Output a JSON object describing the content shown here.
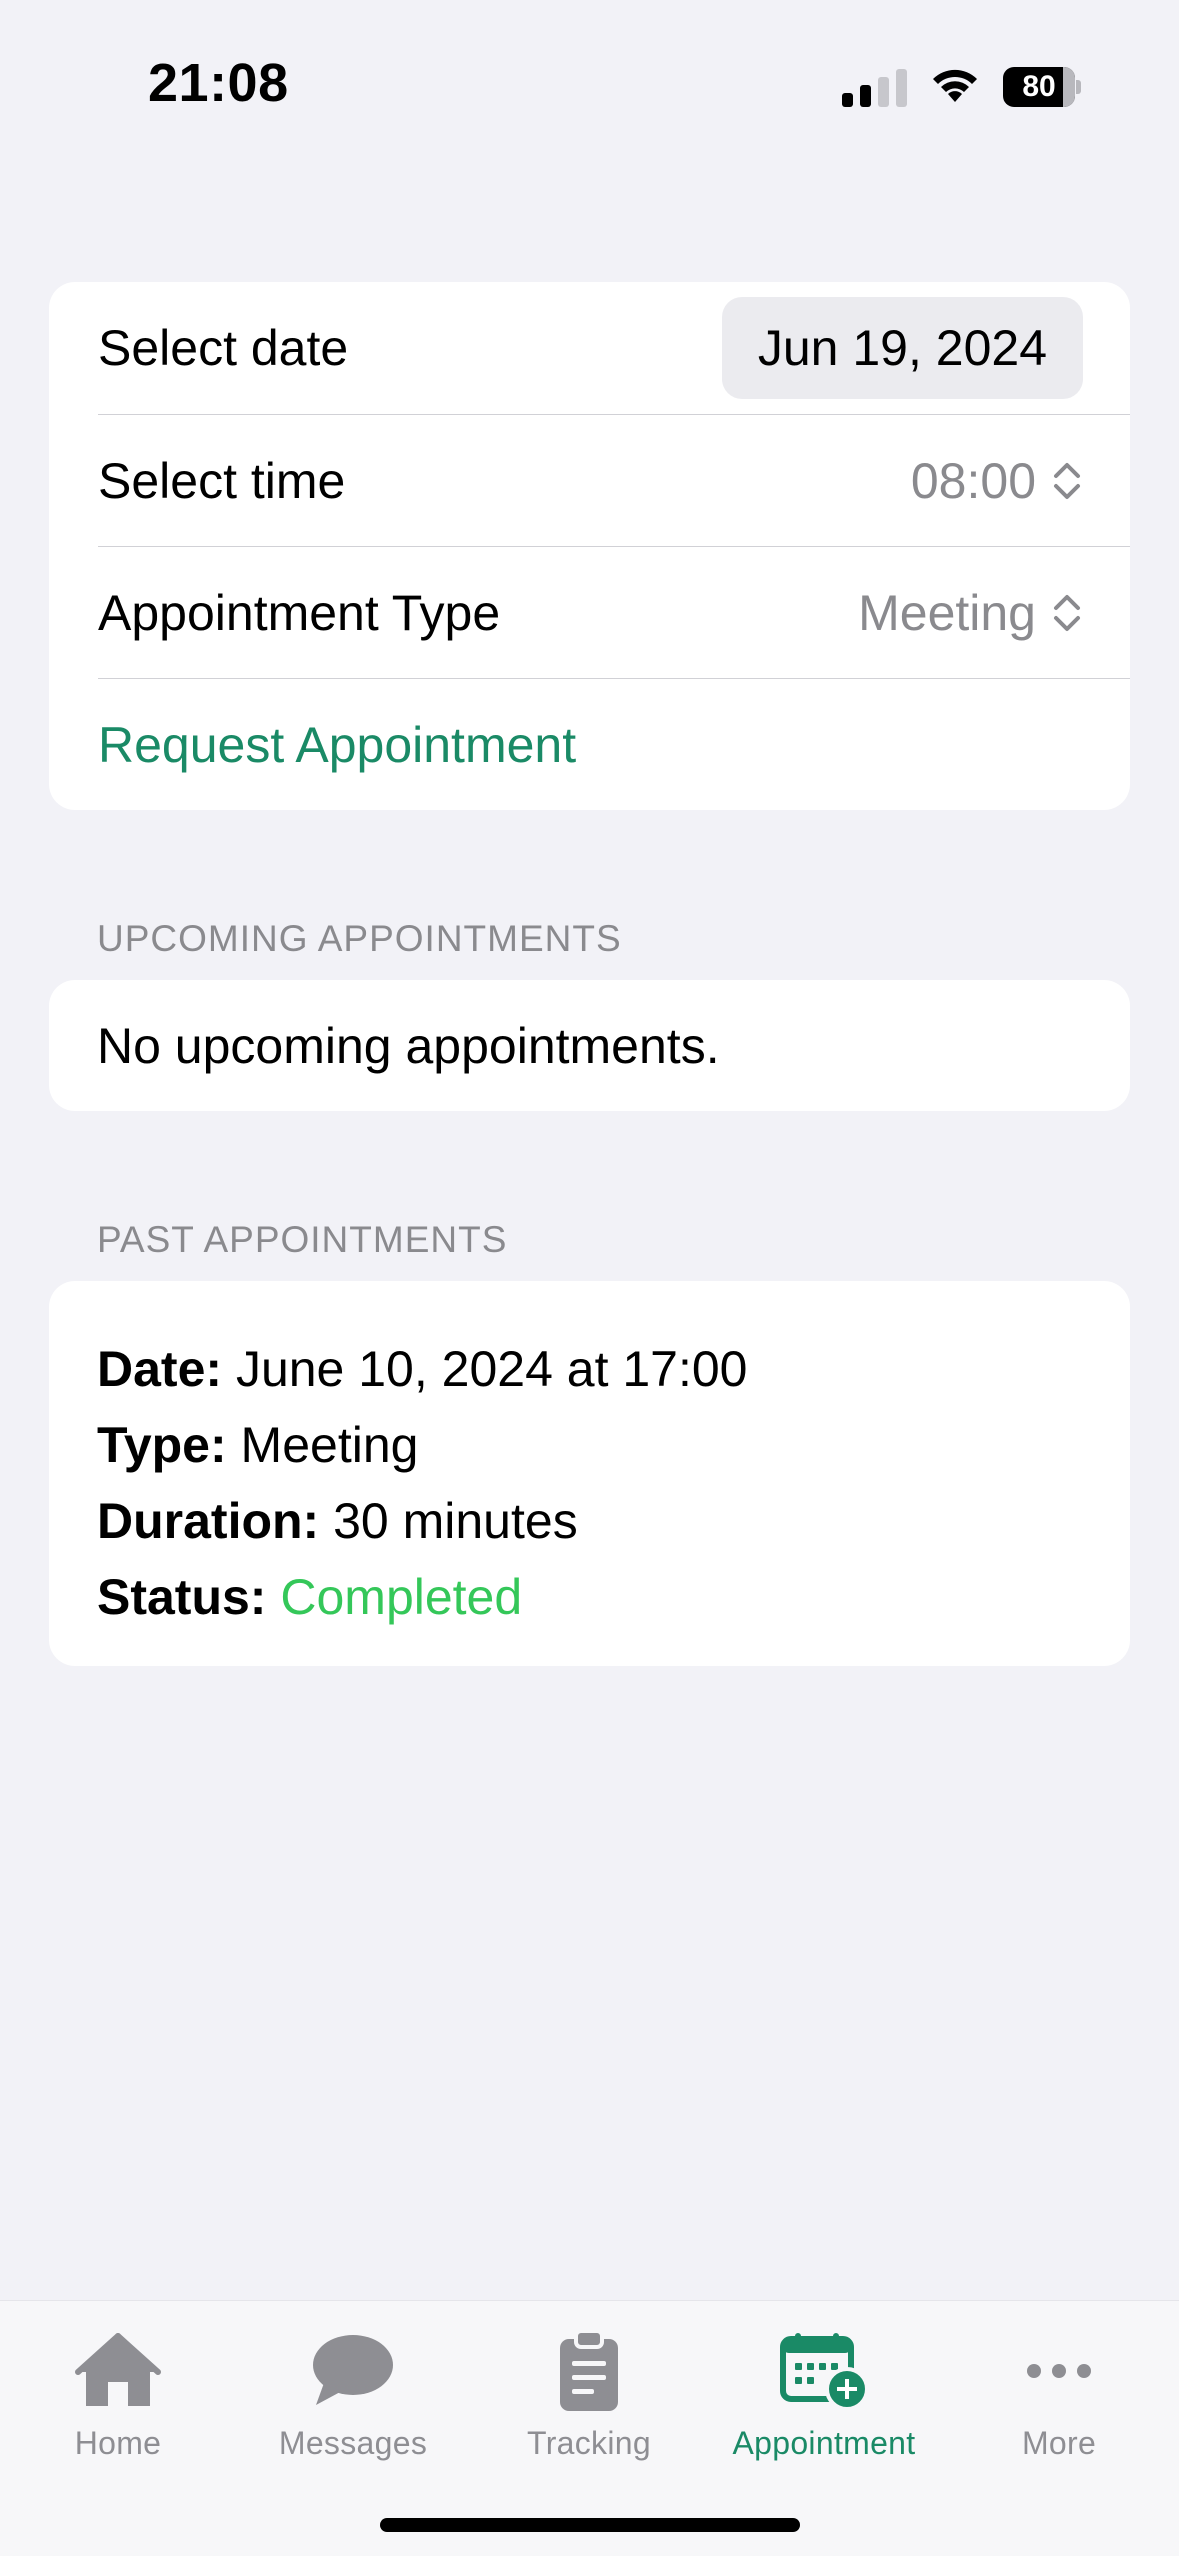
{
  "status_bar": {
    "time": "21:08",
    "battery": "80"
  },
  "form": {
    "date_label": "Select date",
    "date_value": "Jun 19, 2024",
    "time_label": "Select time",
    "time_value": "08:00",
    "type_label": "Appointment Type",
    "type_value": "Meeting",
    "request_label": "Request Appointment"
  },
  "upcoming": {
    "header": "UPCOMING APPOINTMENTS",
    "empty_text": "No upcoming appointments."
  },
  "past": {
    "header": "PAST APPOINTMENTS",
    "items": [
      {
        "date_label": "Date:",
        "date_value": "June 10, 2024 at 17:00",
        "type_label": "Type:",
        "type_value": "Meeting",
        "duration_label": "Duration:",
        "duration_value": "30 minutes",
        "status_label": "Status:",
        "status_value": "Completed"
      }
    ]
  },
  "tabs": [
    {
      "label": "Home",
      "icon": "house-icon"
    },
    {
      "label": "Messages",
      "icon": "chat-bubble-icon"
    },
    {
      "label": "Tracking",
      "icon": "clipboard-icon"
    },
    {
      "label": "Appointment",
      "icon": "calendar-plus-icon",
      "active": true
    },
    {
      "label": "More",
      "icon": "ellipsis-icon"
    }
  ],
  "colors": {
    "accent": "#1a8a66",
    "completed": "#34c759",
    "background": "#f2f2f7",
    "secondary_text": "#8a8a8e"
  }
}
